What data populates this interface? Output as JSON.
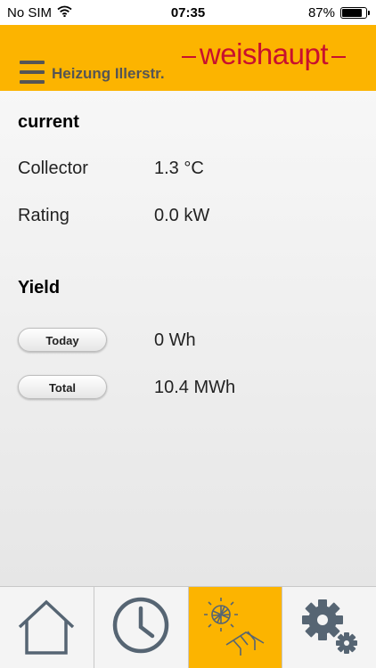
{
  "status_bar": {
    "carrier": "No SIM",
    "time": "07:35",
    "battery_percent": "87%",
    "battery_level": 0.87,
    "icons": [
      "wifi-icon",
      "battery-icon"
    ]
  },
  "header": {
    "menu_icon": "hamburger-menu-icon",
    "title": "Heizung Illerstr.",
    "brand": "weishaupt",
    "colors": {
      "header_background": "#fcb400",
      "brand": "#c8102e",
      "title": "#555555"
    }
  },
  "current": {
    "title": "current",
    "rows": [
      {
        "label": "Collector",
        "value": "1.3 °C"
      },
      {
        "label": "Rating",
        "value": "0.0 kW"
      }
    ]
  },
  "yield": {
    "title": "Yield",
    "rows": [
      {
        "button_label": "Today",
        "value": "0 Wh"
      },
      {
        "button_label": "Total",
        "value": "10.4 MWh"
      }
    ]
  },
  "tab_bar": {
    "active_tab": "solar",
    "active_color": "#fcb400",
    "tabs": [
      {
        "id": "home",
        "icon": "house-icon"
      },
      {
        "id": "schedule",
        "icon": "clock-icon"
      },
      {
        "id": "solar",
        "icon": "solar-panel-icon"
      },
      {
        "id": "settings",
        "icon": "gears-icon"
      }
    ]
  }
}
